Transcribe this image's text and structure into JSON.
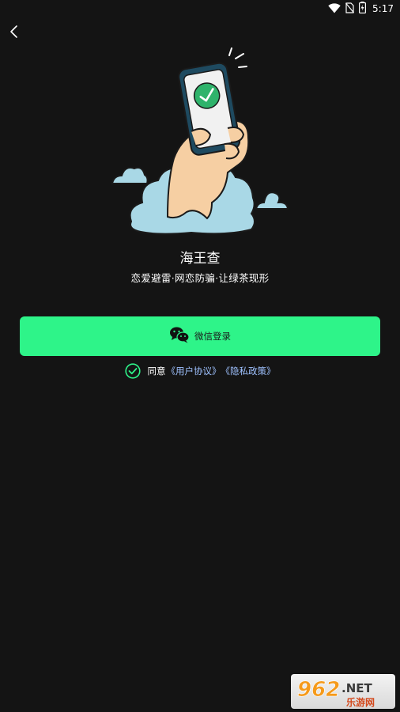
{
  "status_bar": {
    "time": "5:17",
    "icons": [
      "wifi-icon",
      "no-sim-icon",
      "battery-charging-icon"
    ]
  },
  "nav": {
    "back_icon": "chevron-left-icon"
  },
  "hero": {
    "illustration": "hand-holding-phone-with-checkmark"
  },
  "app": {
    "title": "海王查",
    "slogan": "恋爱避雷·网恋防骗·让绿茶现形"
  },
  "login": {
    "button_label": "微信登录",
    "icon": "wechat-icon",
    "accent_color": "#2ef489"
  },
  "agreement": {
    "prefix": "同意",
    "user_agreement": "《用户协议》",
    "privacy_policy": "《隐私政策》",
    "checked": true,
    "check_color": "#2ef489",
    "link_color": "#9fc2ff"
  },
  "watermark": {
    "brand": "962.NET",
    "subtitle": "乐游网"
  }
}
